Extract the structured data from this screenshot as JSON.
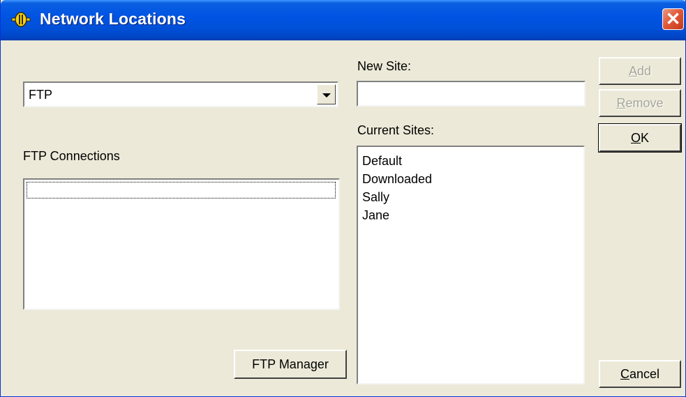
{
  "window": {
    "title": "Network Locations",
    "close_label": "✕",
    "icon": "network-locations-app-icon"
  },
  "left": {
    "protocol_select": {
      "selected": "FTP",
      "options": [
        "FTP"
      ]
    },
    "connections_label": "FTP Connections",
    "connections": [],
    "ftp_manager_label": "FTP Manager"
  },
  "right": {
    "new_site_label": "New Site:",
    "new_site_value": "",
    "current_sites_label": "Current Sites:",
    "current_sites": [
      "Default",
      "Downloaded",
      "Sally",
      "Jane"
    ]
  },
  "buttons": {
    "add": {
      "mnemonic": "A",
      "rest": "dd",
      "enabled": false
    },
    "remove": {
      "mnemonic": "R",
      "rest": "emove",
      "enabled": false
    },
    "ok": {
      "mnemonic": "O",
      "rest": "K",
      "enabled": true
    },
    "cancel": {
      "mnemonic": "C",
      "rest": "ancel",
      "enabled": true
    }
  },
  "colors": {
    "titlebar": "#0054e3",
    "dialog_bg": "#ece9d8",
    "close_button": "#e15a3a",
    "disabled_text": "#a7a69b"
  }
}
